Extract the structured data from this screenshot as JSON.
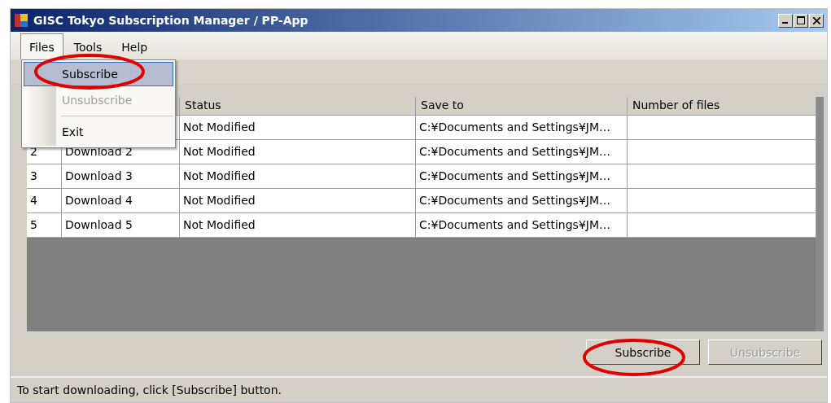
{
  "window": {
    "title": "GISC Tokyo Subscription Manager / PP-App"
  },
  "menu": [
    {
      "label": "Files",
      "selected": true
    },
    {
      "label": "Tools",
      "selected": false
    },
    {
      "label": "Help",
      "selected": false
    }
  ],
  "dropdown": [
    {
      "kind": "item",
      "label": "Subscribe",
      "selected": true,
      "disabled": false
    },
    {
      "kind": "item",
      "label": "Unsubscribe",
      "selected": false,
      "disabled": true
    },
    {
      "kind": "separator"
    },
    {
      "kind": "item",
      "label": "Exit",
      "selected": false,
      "disabled": false
    }
  ],
  "table": {
    "columns": [
      null,
      null,
      "Status",
      "Save to",
      "Number of files"
    ],
    "rows": [
      {
        "cells": [
          null,
          null,
          "Not Modified",
          "C:¥Documents and Settings¥JM…",
          null
        ]
      },
      {
        "cells": [
          "2",
          "Download 2",
          "Not Modified",
          "C:¥Documents and Settings¥JM…",
          null
        ]
      },
      {
        "cells": [
          "3",
          "Download 3",
          "Not Modified",
          "C:¥Documents and Settings¥JM…",
          null
        ]
      },
      {
        "cells": [
          "4",
          "Download 4",
          "Not Modified",
          "C:¥Documents and Settings¥JM…",
          null
        ]
      },
      {
        "cells": [
          "5",
          "Download 5",
          "Not Modified",
          "C:¥Documents and Settings¥JM…",
          null
        ]
      }
    ]
  },
  "buttons": [
    {
      "label": "Subscribe",
      "disabled": false
    },
    {
      "label": "Unsubscribe",
      "disabled": true
    }
  ],
  "status_bar": "To start downloading, click [Subscribe] button."
}
